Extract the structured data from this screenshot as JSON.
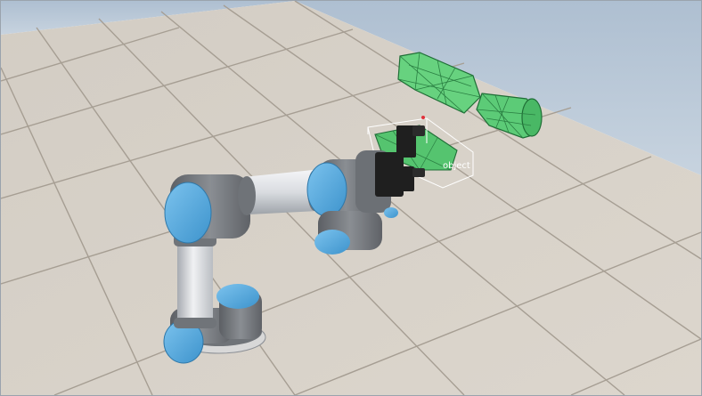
{
  "viewport": {
    "kind": "3d-robot-simulation-view",
    "sky_color": "#b3c6d8",
    "floor_tile_color": "#d6d0c7",
    "floor_grout_color": "#a8a096"
  },
  "robot": {
    "joint_cap_color": "#5aaee3",
    "joint_body_color": "#7a7d82",
    "link_color": "#e3e5e8",
    "gripper_color": "#1e1e1e"
  },
  "target_object": {
    "label": "object",
    "bounding_box_color": "#ffffff"
  },
  "collision_meshes": {
    "color": "#5fcf78",
    "wire_color": "#1c6b32"
  }
}
